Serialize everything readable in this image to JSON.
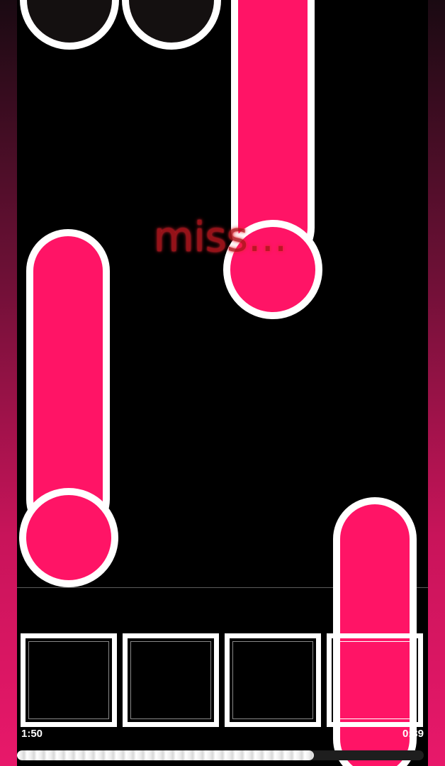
{
  "judgement": "miss...",
  "timer": {
    "elapsed": "1:50",
    "remaining": "0:39"
  },
  "progress": 0.73,
  "lanes": [
    "lane-1",
    "lane-2",
    "lane-3",
    "lane-4"
  ],
  "active_lane": 4,
  "colors": {
    "note": "#ff1466",
    "outline": "#ffffff",
    "judgement": "#b0161d",
    "side_gradient_bottom": "#e8186a"
  }
}
